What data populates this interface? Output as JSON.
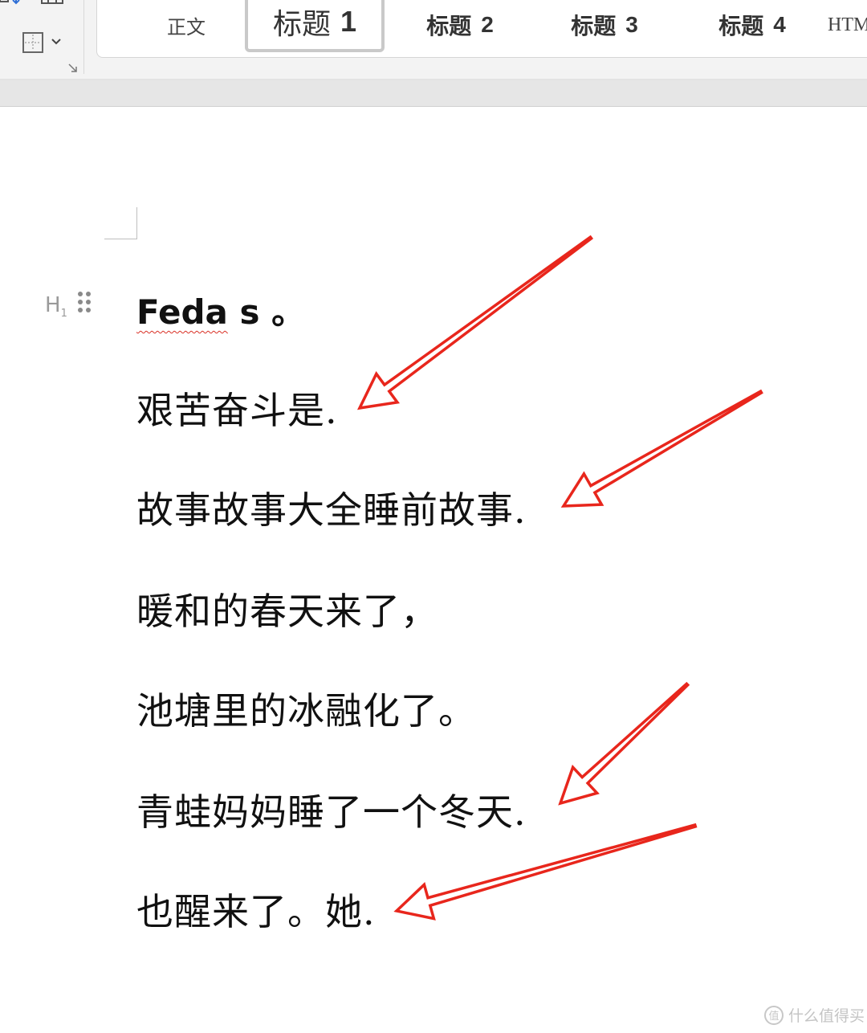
{
  "ribbon": {
    "styles": [
      {
        "label": "正文",
        "num": ""
      },
      {
        "label": "标题",
        "num": "1"
      },
      {
        "label": "标题",
        "num": "2"
      },
      {
        "label": "标题",
        "num": "3"
      },
      {
        "label": "标题",
        "num": "4"
      },
      {
        "label": "HTML",
        "num": ""
      }
    ],
    "selected_style": "标题 1"
  },
  "document": {
    "heading_marker": "H",
    "heading_marker_sub": "1",
    "heading": {
      "word": "Feda",
      "rest": " s",
      "end": " 。"
    },
    "paragraphs": [
      "艰苦奋斗是.",
      "故事故事大全睡前故事.",
      "暖和的春天来了，",
      "池塘里的冰融化了。",
      "青蛙妈妈睡了一个冬天.",
      "也醒来了。她."
    ]
  },
  "annotations": {
    "arrow_color": "#e8261c",
    "arrow_count": 4
  },
  "watermark": {
    "logo": "值",
    "text": "什么值得买"
  }
}
